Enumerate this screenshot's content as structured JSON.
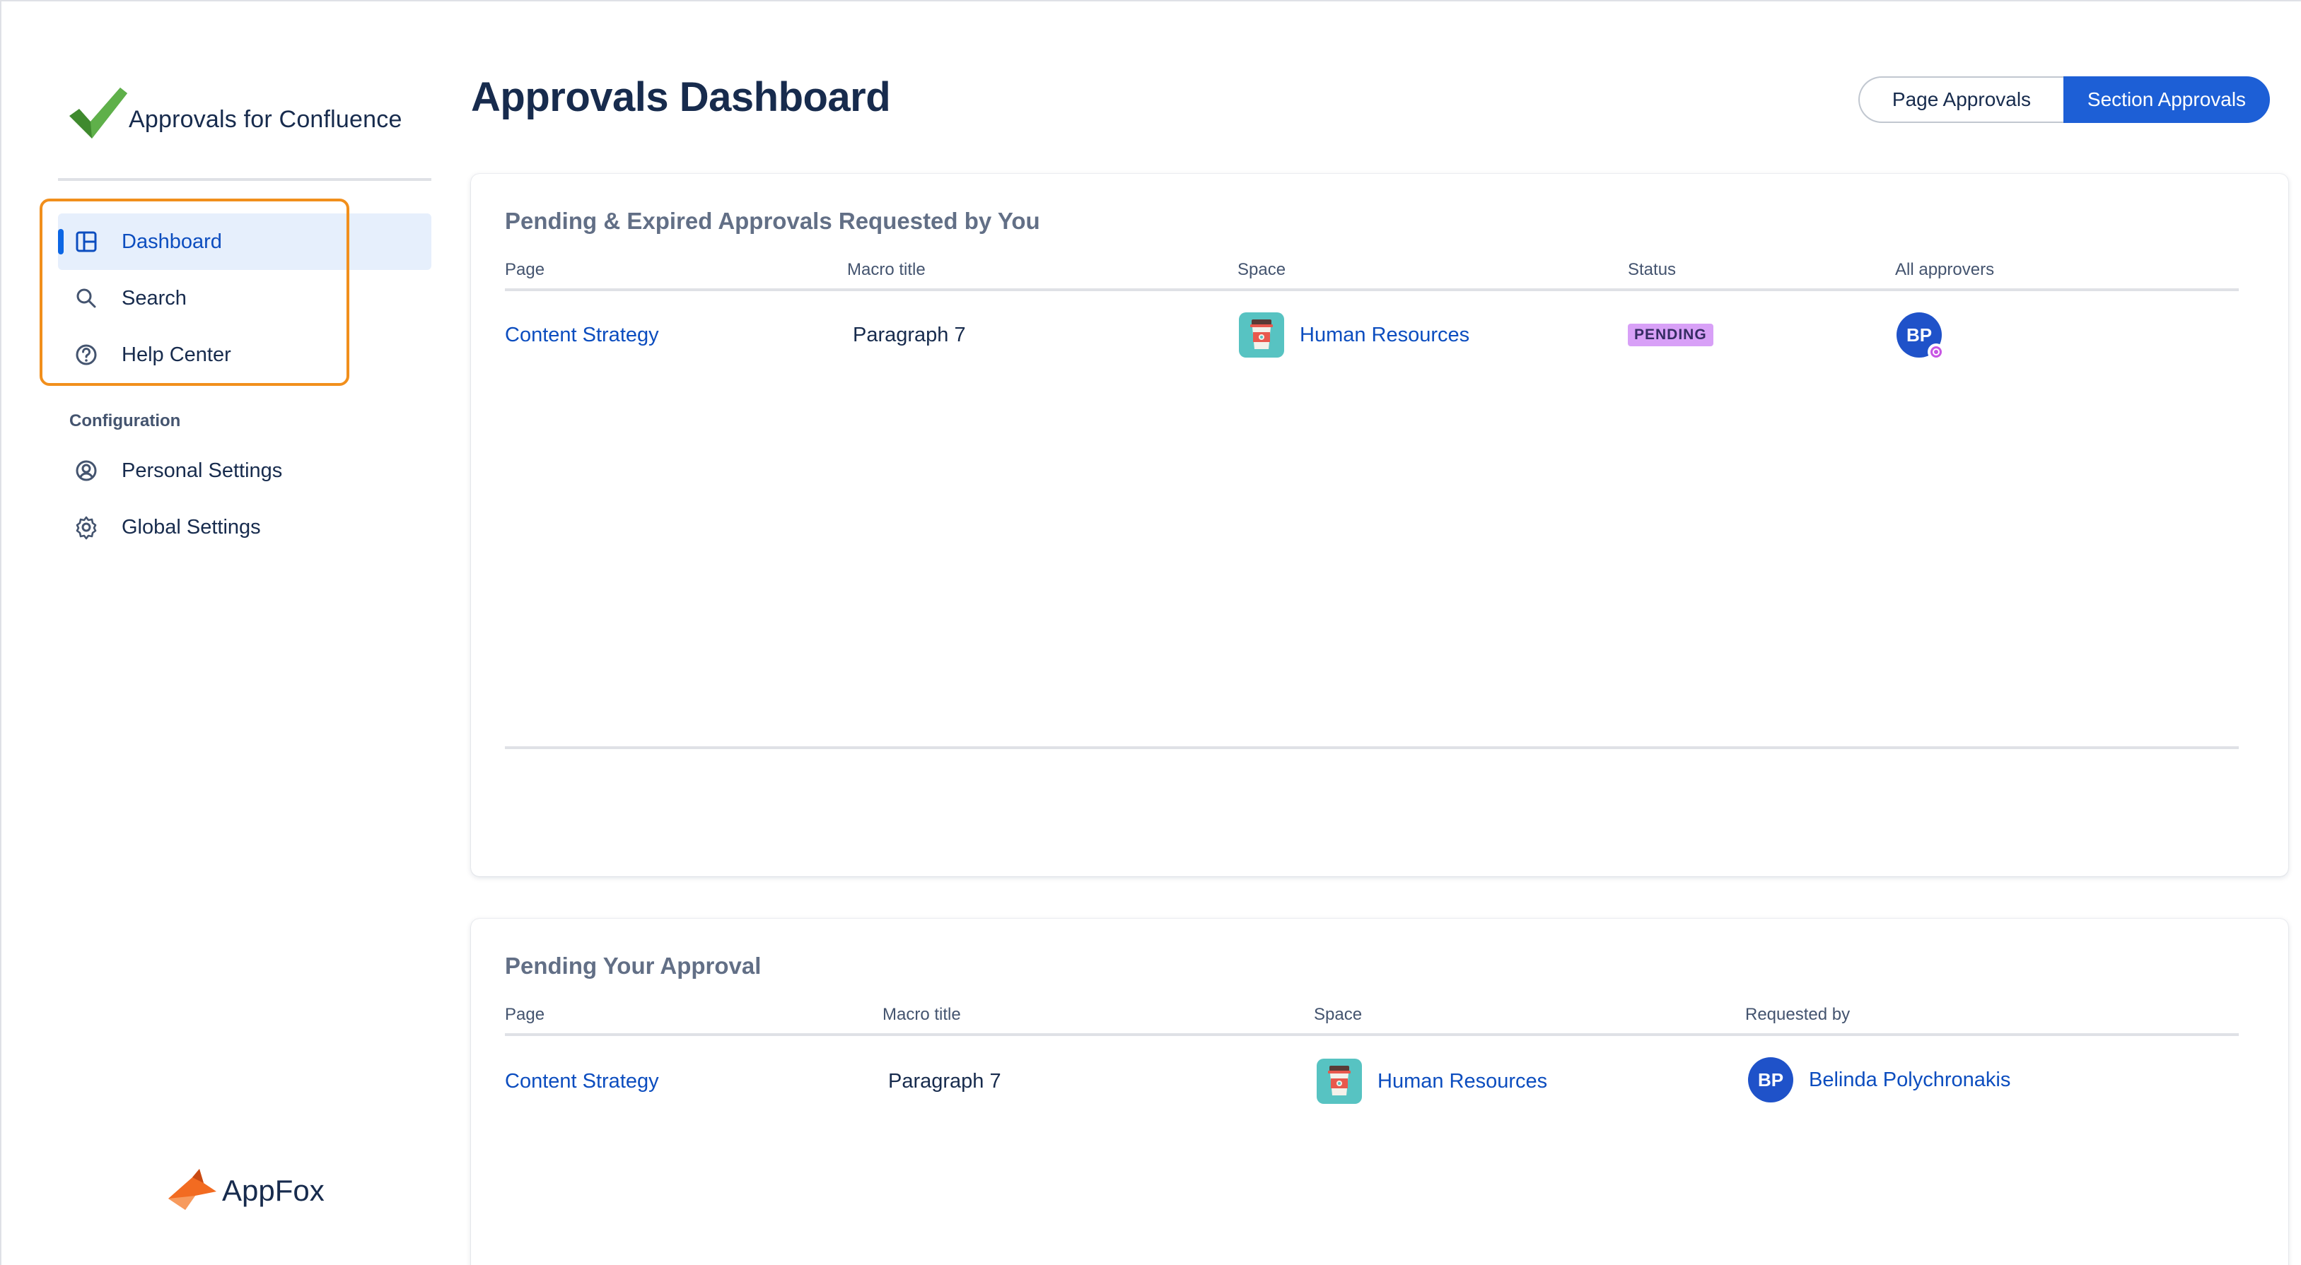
{
  "app": {
    "logo_text": "Approvals for Confluence",
    "brand_footer": "AppFox",
    "accent_color": "#1d5fd6",
    "highlight_color": "#f18f1c"
  },
  "sidebar": {
    "items": [
      {
        "label": "Dashboard",
        "icon": "dashboard-icon",
        "active": true
      },
      {
        "label": "Search",
        "icon": "search-icon",
        "active": false
      },
      {
        "label": "Help Center",
        "icon": "help-icon",
        "active": false
      }
    ],
    "config_label": "Configuration",
    "config_items": [
      {
        "label": "Personal Settings",
        "icon": "user-circle-icon"
      },
      {
        "label": "Global Settings",
        "icon": "gear-icon"
      }
    ]
  },
  "header": {
    "title": "Approvals Dashboard",
    "toggle": {
      "page_label": "Page Approvals",
      "section_label": "Section Approvals",
      "selected": "Section Approvals"
    }
  },
  "requested_by_you": {
    "title": "Pending & Expired Approvals Requested by You",
    "columns": [
      "Page",
      "Macro title",
      "Space",
      "Status",
      "All approvers"
    ],
    "rows": [
      {
        "page": "Content Strategy",
        "macro_title": "Paragraph 7",
        "space": "Human Resources",
        "status": "PENDING",
        "approver_initials": "BP"
      }
    ]
  },
  "pending_your_approval": {
    "title": "Pending Your Approval",
    "columns": [
      "Page",
      "Macro title",
      "Space",
      "Requested by"
    ],
    "rows": [
      {
        "page": "Content Strategy",
        "macro_title": "Paragraph 7",
        "space": "Human Resources",
        "requester_initials": "BP",
        "requested_by": "Belinda Polychronakis"
      }
    ]
  }
}
